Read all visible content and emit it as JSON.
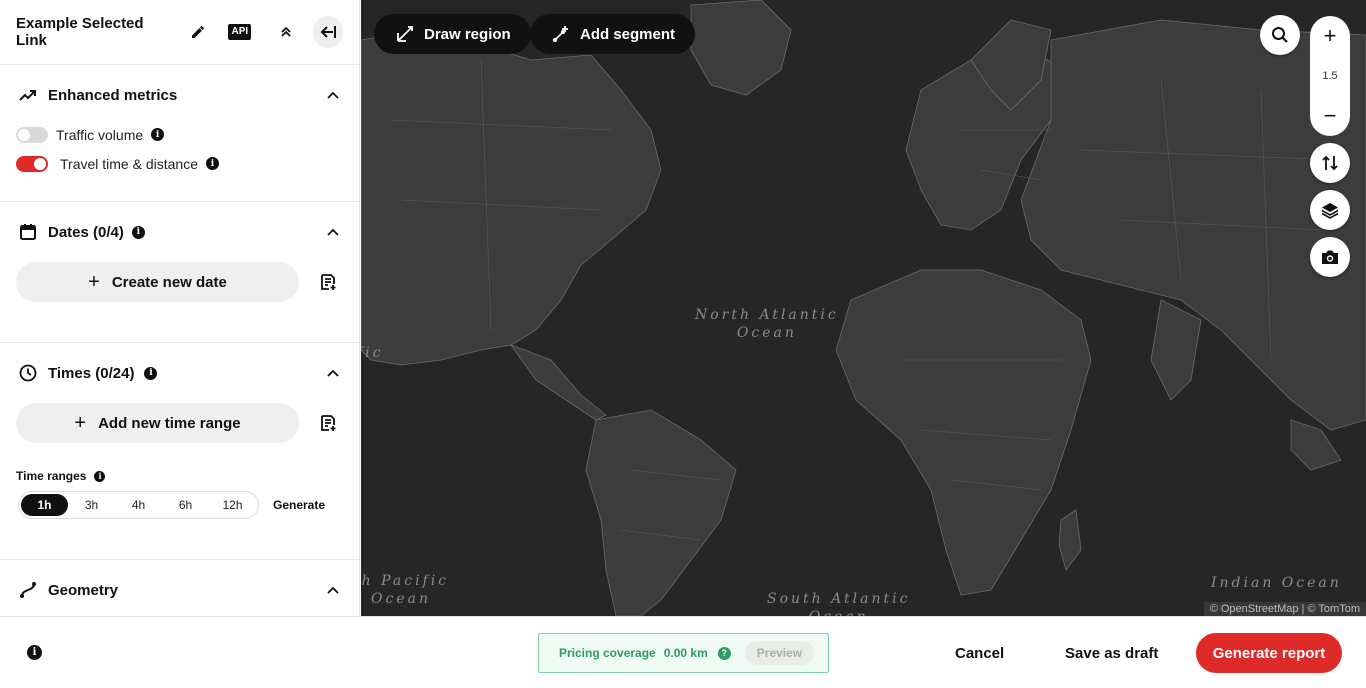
{
  "header": {
    "title": "Example Selected Link",
    "api_label": "API"
  },
  "sections": {
    "metrics": {
      "title": "Enhanced metrics",
      "traffic_volume": {
        "label": "Traffic volume",
        "enabled": false
      },
      "travel_time": {
        "label": "Travel time & distance",
        "enabled": true
      }
    },
    "dates": {
      "title": "Dates (0/4)",
      "create_label": "Create new date"
    },
    "times": {
      "title": "Times (0/24)",
      "add_label": "Add new time range",
      "ranges_label": "Time ranges",
      "options": [
        "1h",
        "3h",
        "4h",
        "6h",
        "12h"
      ],
      "selected": "1h",
      "generate_label": "Generate"
    },
    "geometry": {
      "title": "Geometry"
    }
  },
  "map": {
    "draw_region_label": "Draw region",
    "add_segment_label": "Add segment",
    "zoom_in": "+",
    "zoom_level": "1.5",
    "zoom_out": "−",
    "oceans": {
      "north_atlantic_line1": "North Atlantic",
      "north_atlantic_line2": "Ocean",
      "pacific_fragment": "fic",
      "south_pacific_line1": "th Pacific",
      "south_pacific_line2": "Ocean",
      "south_atlantic_line1": "South Atlantic",
      "south_atlantic_line2": "Ocean",
      "indian_line1": "Indian Ocean"
    },
    "attribution": "© OpenStreetMap | © TomTom"
  },
  "footer": {
    "pricing_label": "Pricing coverage",
    "pricing_value": "0.00 km",
    "preview_label": "Preview",
    "cancel_label": "Cancel",
    "draft_label": "Save as draft",
    "generate_label": "Generate report"
  },
  "colors": {
    "accent": "#df2a2a",
    "map_bg": "#262626",
    "land": "#3c3c3c",
    "pricing_green": "#2f9a62"
  }
}
